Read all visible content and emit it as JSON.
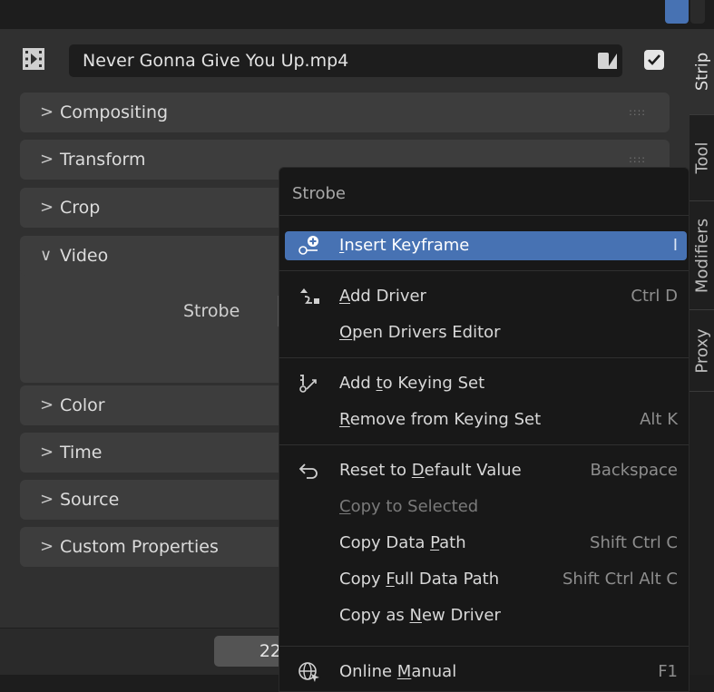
{
  "strip": {
    "name": "Never Gonna Give You Up.mp4"
  },
  "sections": [
    {
      "label": "Compositing",
      "expanded": false
    },
    {
      "label": "Transform",
      "expanded": false
    },
    {
      "label": "Crop",
      "expanded": false
    },
    {
      "label": "Video",
      "expanded": true
    },
    {
      "label": "Color",
      "expanded": false
    },
    {
      "label": "Time",
      "expanded": false
    },
    {
      "label": "Source",
      "expanded": false
    },
    {
      "label": "Custom Properties",
      "expanded": false
    }
  ],
  "chevrons": {
    "collapsed": ">",
    "expanded": "∨"
  },
  "grip_glyph": "::::",
  "video": {
    "strobe_label": "Strobe"
  },
  "bottom": {
    "frame_value": "22"
  },
  "side_tabs": [
    "Strip",
    "Tool",
    "Modifiers",
    "Proxy"
  ],
  "context_menu": {
    "title": "Strobe",
    "items": [
      {
        "pre": "",
        "ul": "I",
        "post": "nsert Keyframe",
        "shortcut": "I",
        "icon": "keyframe-insert-icon",
        "highlighted": true
      },
      {
        "pre": "",
        "ul": "A",
        "post": "dd Driver",
        "shortcut": "Ctrl D",
        "icon": "driver-icon"
      },
      {
        "pre": "",
        "ul": "O",
        "post": "pen Drivers Editor",
        "shortcut": ""
      },
      {
        "pre": "Add ",
        "ul": "t",
        "post": "o Keying Set",
        "shortcut": "",
        "icon": "keying-set-icon"
      },
      {
        "pre": "",
        "ul": "R",
        "post": "emove from Keying Set",
        "shortcut": "Alt K"
      },
      {
        "pre": "Reset to ",
        "ul": "D",
        "post": "efault Value",
        "shortcut": "Backspace",
        "icon": "reset-icon"
      },
      {
        "pre": "",
        "ul": "C",
        "post": "opy to Selected",
        "shortcut": "",
        "disabled": true
      },
      {
        "pre": "Copy Data ",
        "ul": "P",
        "post": "ath",
        "shortcut": "Shift Ctrl C"
      },
      {
        "pre": "Copy ",
        "ul": "F",
        "post": "ull Data Path",
        "shortcut": "Shift Ctrl Alt C"
      },
      {
        "pre": "Copy as ",
        "ul": "N",
        "post": "ew Driver",
        "shortcut": ""
      },
      {
        "pre": "Online ",
        "ul": "M",
        "post": "anual",
        "shortcut": "F1",
        "icon": "globe-icon"
      }
    ]
  },
  "colors": {
    "accent": "#4772b3",
    "menu_bg": "#181818",
    "panel_bg": "#303030"
  }
}
